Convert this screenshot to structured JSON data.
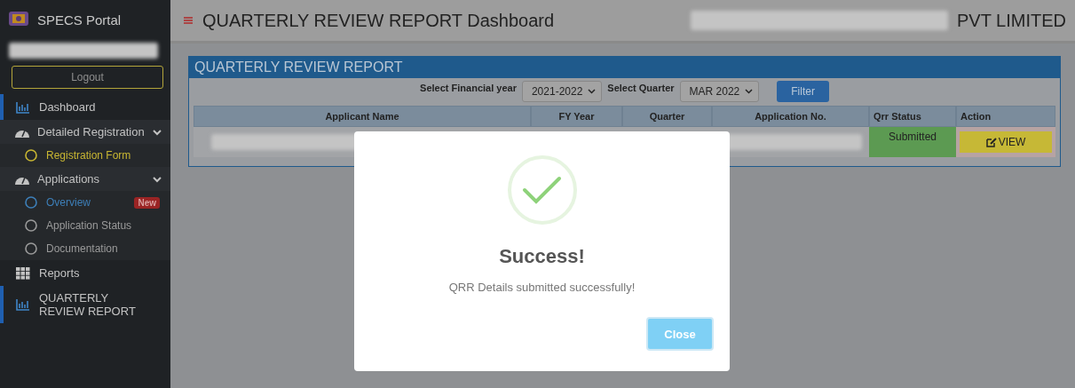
{
  "sidebar": {
    "brand": "SPECS Portal",
    "logout": "Logout",
    "items": [
      {
        "kind": "chart",
        "label": "Dashboard",
        "active": true
      },
      {
        "kind": "group",
        "label": "Detailed Registration",
        "expanded": true,
        "children": [
          {
            "label": "Registration Form",
            "color": "#c8b632"
          }
        ]
      },
      {
        "kind": "group",
        "label": "Applications",
        "expanded": true,
        "children": [
          {
            "label": "Overview",
            "color": "#3d7fb8",
            "badge": "New"
          },
          {
            "label": "Application Status",
            "color": "#9a9a9a"
          },
          {
            "label": "Documentation",
            "color": "#9a9a9a"
          }
        ]
      },
      {
        "kind": "grid",
        "label": "Reports",
        "active": false
      },
      {
        "kind": "chart",
        "label": "QUARTERLY REVIEW REPORT",
        "active": true
      }
    ]
  },
  "header": {
    "title": "QUARTERLY REVIEW REPORT Dashboard",
    "company": "PVT LIMITED"
  },
  "panel": {
    "title": "QUARTERLY REVIEW REPORT",
    "filters": [
      {
        "label": "Select Financial year",
        "value": "2021-2022"
      },
      {
        "label": "Select Quarter",
        "value": "MAR 2022"
      }
    ],
    "filter_button": "Filter",
    "table": {
      "columns": [
        "Applicant Name",
        "FY Year",
        "Quarter",
        "Application No.",
        "Qrr Status",
        "Action"
      ],
      "rows": [
        {
          "status": "Submitted",
          "action": "VIEW"
        }
      ]
    }
  },
  "dialog": {
    "title": "Success!",
    "message": "QRR Details submitted successfully!",
    "button": "Close"
  }
}
